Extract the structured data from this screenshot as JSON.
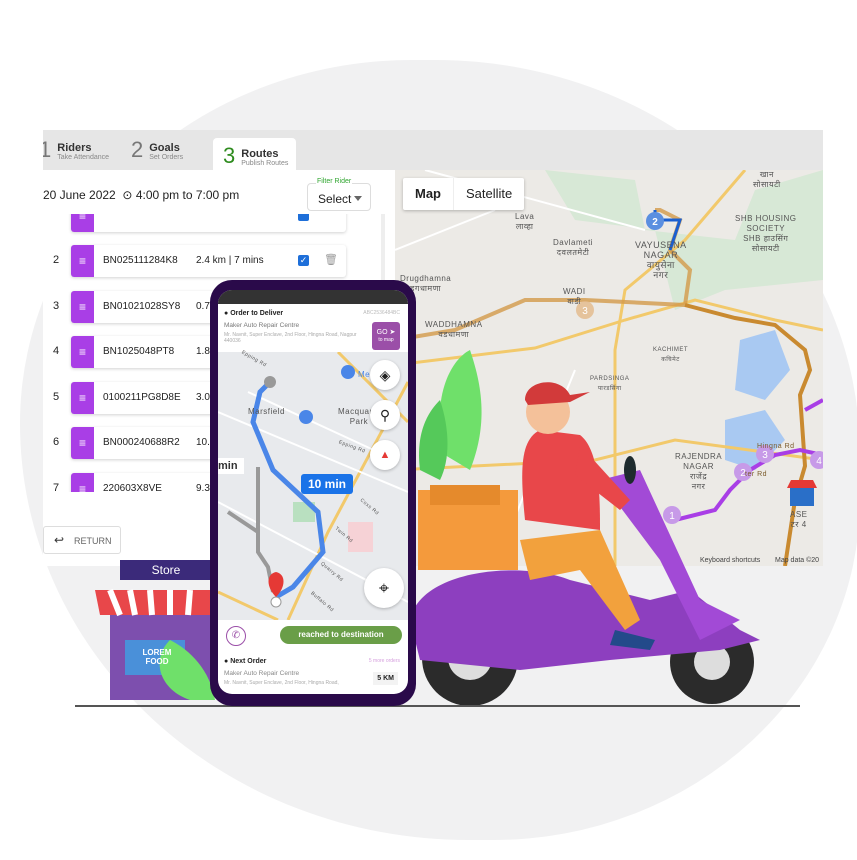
{
  "tabs": [
    {
      "num": "1",
      "title": "Riders",
      "subtitle": "Take Attendance"
    },
    {
      "num": "2",
      "title": "Goals",
      "subtitle": "Set Orders"
    },
    {
      "num": "3",
      "title": "Routes",
      "subtitle": "Publish Routes"
    }
  ],
  "date": "20 June 2022",
  "time_icon": "clock-icon",
  "time_range": "4:00 pm to 7:00 pm",
  "filter": {
    "label": "Filter Rider",
    "value": "Select"
  },
  "rows": [
    {
      "index": "2",
      "code": "BN025111284K8",
      "distance": "2.4 km | 7 mins",
      "checked": true
    },
    {
      "index": "3",
      "code": "BN01021028SY8",
      "distance": "0.7"
    },
    {
      "index": "4",
      "code": "BN1025048PT8",
      "distance": "1.8"
    },
    {
      "index": "5",
      "code": "0100211PG8D8E",
      "distance": "3.0"
    },
    {
      "index": "6",
      "code": "BN000240688R2",
      "distance": "10."
    },
    {
      "index": "7",
      "code": "220603X8VE",
      "distance": "9.3"
    }
  ],
  "return_label": "RETURN",
  "map": {
    "type_buttons": [
      "Map",
      "Satellite"
    ],
    "labels": {
      "lava": "Lava\nलाव्हा",
      "davlameti": "Davlameti\nदवलतमेटी",
      "vayusena": "VAYUSENA\nNAGAR\nवायुसेना\nनगर",
      "shb": "SHB HOUSING\nSOCIETY\nSHB हाउसिंग\nसोसायटी",
      "khan": "खान\nसोसायटी",
      "drugdhamna": "Drugdhamna\nड्रगधामणा",
      "wadi": "WADI\nवाडी",
      "waddhamna": "WADDHAMNA\nवडधामणा",
      "kachimet": "KACHIMET\nकचिमेट",
      "pardsinga": "PARDSINGA\nपारडसिंगा",
      "rajendra": "RAJENDRA\nNAGAR\nराजेंद्र\nनगर",
      "hingna_rd": "Hingna Rd",
      "ter_rd": "ter Rd",
      "sena": "ASE\nटर 4"
    },
    "markers": [
      "2",
      "3",
      "1",
      "2",
      "3",
      "4"
    ],
    "keyboard": "Keyboard shortcuts",
    "mapdata": "Map data ©20"
  },
  "phone": {
    "order_title": "Order to Deliver",
    "order_id": "ABC2536484BC",
    "order_name": "Maker Auto Repair Centre",
    "order_address": "Mr. Navnit, Super Enclave, 2nd Floor, Hingna Road, Nagpur 440036",
    "go_label": "GO",
    "go_sub": "to map",
    "map_labels": {
      "marsfield": "Marsfield",
      "macquarie": "Macquarie\nPark",
      "epping1": "Epping Rd",
      "epping2": "Epping Rd",
      "coxs": "Coxs Rd",
      "twin": "Twin Rd",
      "quarry": "Quarry Rd",
      "buffalo": "Buffalo Rd",
      "me": "Me"
    },
    "eta": "10 min",
    "eta_alt": "min",
    "reached": "reached to destination",
    "next_title": "Next Order",
    "more_orders": "5 more orders",
    "next_name": "Maker Auto Repair Centre",
    "next_address": "Mr. Navnit, Super Enclave, 2nd Floor, Hingna Road,",
    "next_km": "5 KM"
  },
  "store": {
    "sign": "Store",
    "board": "LOREM\nFOOD"
  },
  "colors": {
    "accent_purple": "#a93ee6",
    "phone_frame": "#2a0a4a",
    "active_tab": "#2e8b1e",
    "reached_green": "#6a9e48",
    "route_orange": "#d39a4a"
  }
}
